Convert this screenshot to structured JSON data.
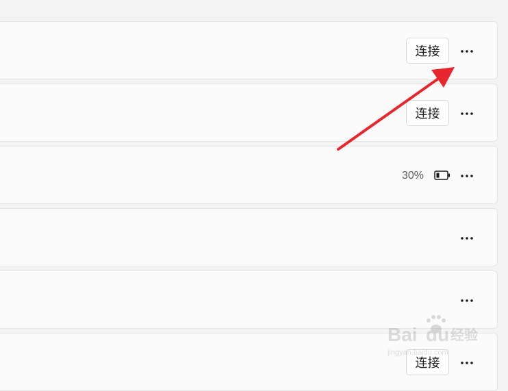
{
  "devices": [
    {
      "action_label": "连接"
    },
    {
      "action_label": "连接"
    },
    {
      "battery_level": "30%"
    },
    {},
    {},
    {
      "action_label": "连接"
    }
  ],
  "colors": {
    "annotation_arrow": "#e8262e",
    "card_background": "#fbfbfb",
    "page_background": "#f3f3f3"
  },
  "watermark": {
    "logo_text": "Baidu经验",
    "site_text": "jingyan.baidu.com"
  }
}
